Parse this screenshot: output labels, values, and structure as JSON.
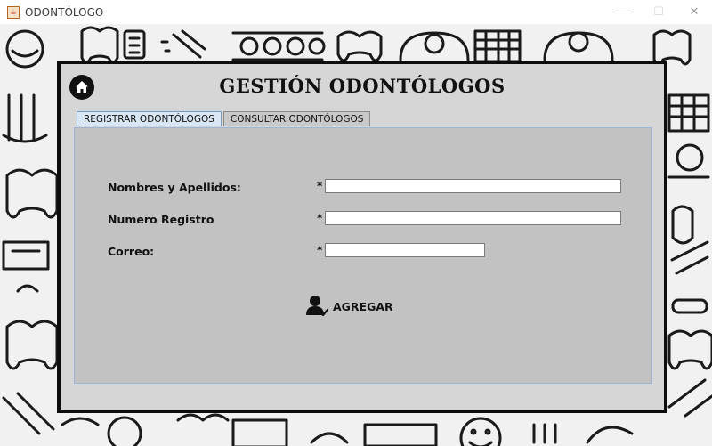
{
  "window": {
    "title": "ODONTÓLOGO",
    "controls": [
      "minimize",
      "maximize",
      "close"
    ]
  },
  "header": {
    "title": "GESTIÓN ODONTÓLOGOS",
    "home_icon": "home-icon"
  },
  "tabs": [
    {
      "label": "REGISTRAR ODONTÓLOGOS",
      "active": true
    },
    {
      "label": "CONSULTAR ODONTÓLOGOS",
      "active": false
    }
  ],
  "form": {
    "fields": [
      {
        "label": "Nombres y Apellidos:",
        "required_mark": "*",
        "value": ""
      },
      {
        "label": "Numero Registro",
        "required_mark": "*",
        "value": ""
      },
      {
        "label": "Correo:",
        "required_mark": "*",
        "value": ""
      }
    ],
    "submit": {
      "label": "AGREGAR",
      "icon": "add-user-icon"
    }
  },
  "colors": {
    "panel_border": "#0d0d0d",
    "tab_active": "#d9e6f4",
    "content_bg": "#c2c2c2"
  }
}
